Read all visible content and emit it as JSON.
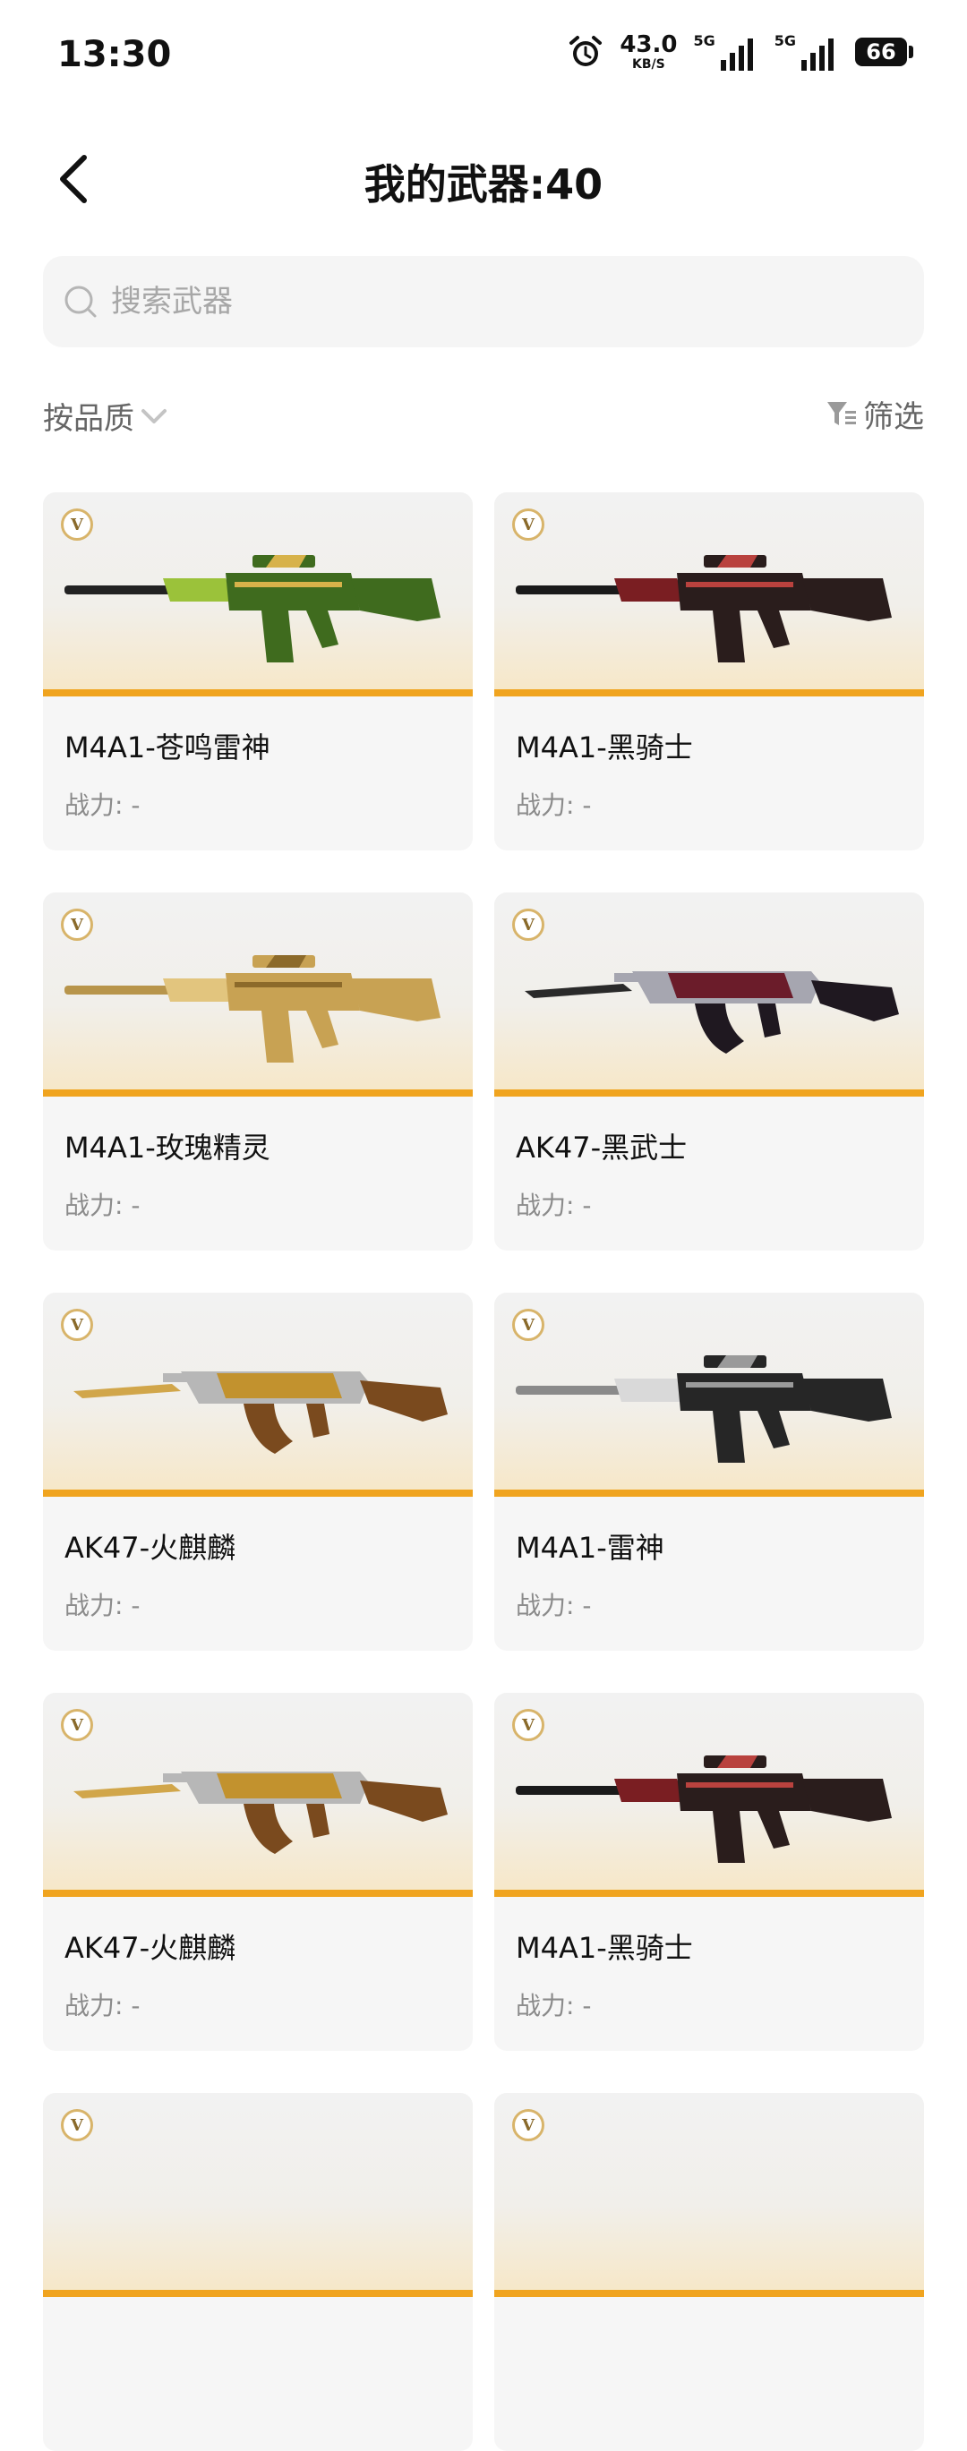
{
  "status_bar": {
    "time": "13:30",
    "speed_value": "43.0",
    "speed_unit": "KB/S",
    "net1_label": "5G",
    "net2_label": "5G",
    "battery": "66"
  },
  "header": {
    "title": "我的武器:40"
  },
  "search": {
    "placeholder": "搜索武器"
  },
  "toolbar": {
    "sort_label": "按品质",
    "filter_label": "筛选"
  },
  "weapons": [
    {
      "name": "M4A1-苍鸣雷神",
      "power": "战力: -",
      "badge": "V",
      "icon": "rifle-green-dragon-icon",
      "style": "green"
    },
    {
      "name": "M4A1-黑骑士",
      "power": "战力: -",
      "badge": "V",
      "icon": "rifle-black-knight-icon",
      "style": "darkred"
    },
    {
      "name": "M4A1-玫瑰精灵",
      "power": "战力: -",
      "badge": "V",
      "icon": "rifle-gold-rose-icon",
      "style": "gold"
    },
    {
      "name": "AK47-黑武士",
      "power": "战力: -",
      "badge": "V",
      "icon": "rifle-black-warrior-icon",
      "style": "ak-dark"
    },
    {
      "name": "AK47-火麒麟",
      "power": "战力: -",
      "badge": "V",
      "icon": "rifle-fire-qilin-icon",
      "style": "ak-gold"
    },
    {
      "name": "M4A1-雷神",
      "power": "战力: -",
      "badge": "V",
      "icon": "rifle-thunder-god-icon",
      "style": "silver"
    },
    {
      "name": "AK47-火麒麟",
      "power": "战力: -",
      "badge": "V",
      "icon": "rifle-fire-qilin-icon",
      "style": "ak-gold"
    },
    {
      "name": "M4A1-黑骑士",
      "power": "战力: -",
      "badge": "V",
      "icon": "rifle-black-knight-icon",
      "style": "darkred"
    },
    {
      "name": "",
      "power": "",
      "badge": "V",
      "icon": "rifle-icon",
      "style": "none"
    },
    {
      "name": "",
      "power": "",
      "badge": "V",
      "icon": "rifle-icon",
      "style": "none"
    }
  ]
}
